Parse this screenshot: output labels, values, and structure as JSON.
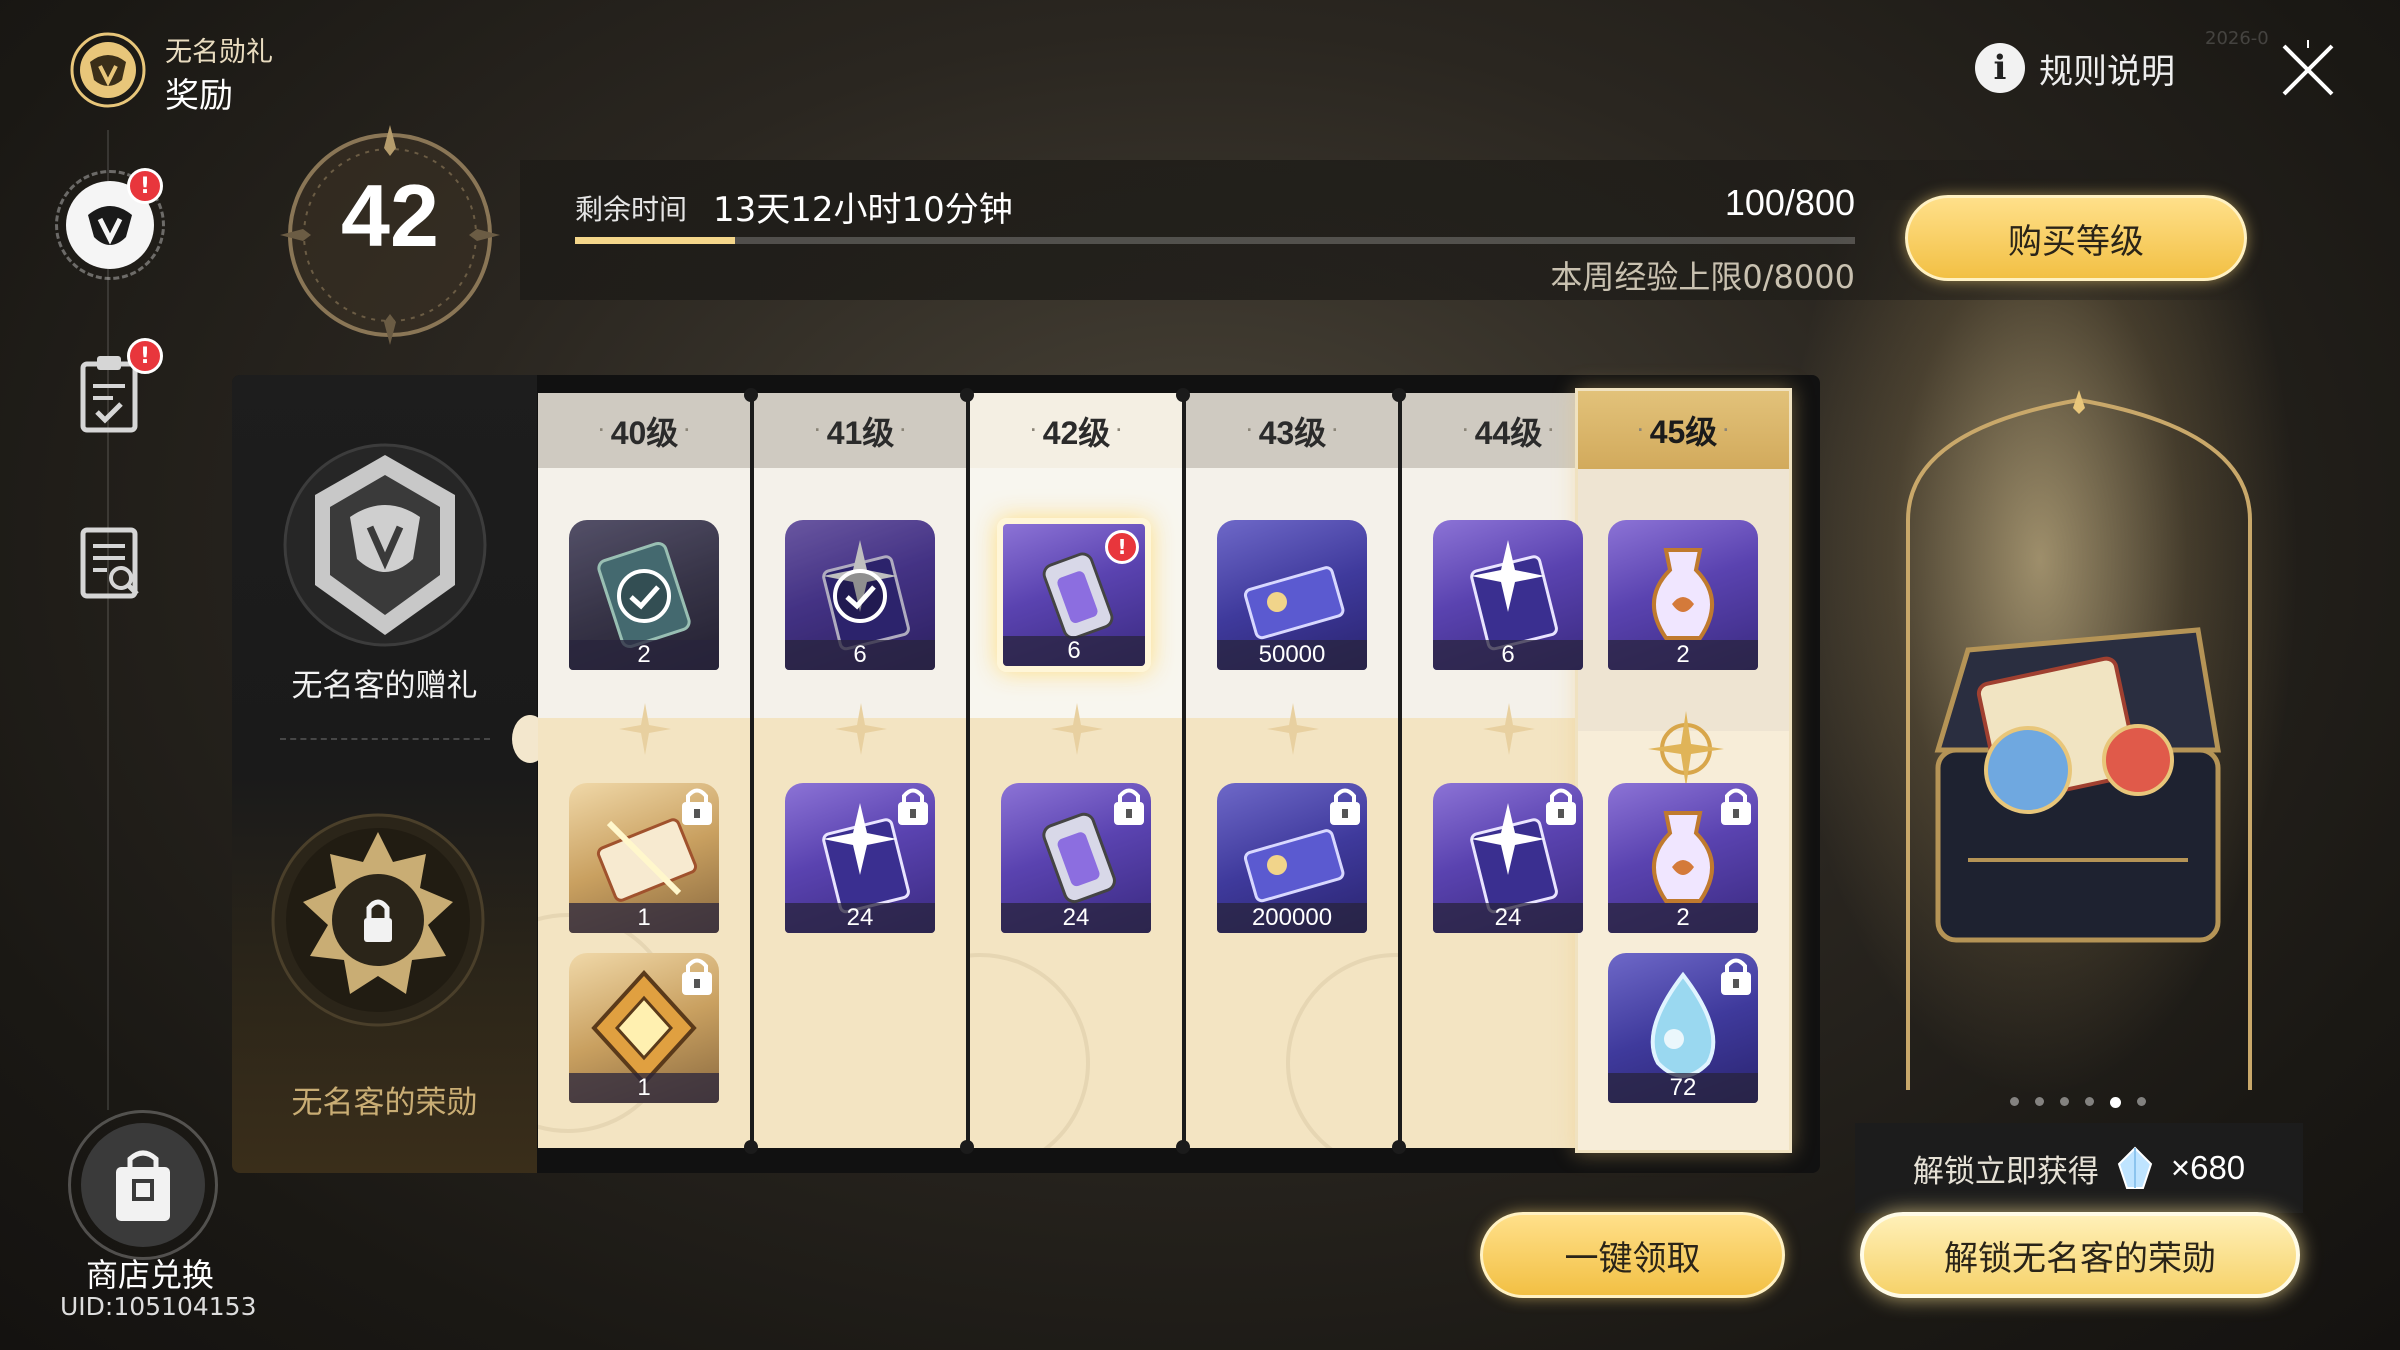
{
  "header": {
    "subtitle": "无名勋礼",
    "title": "奖励",
    "rules_label": "规则说明",
    "timestamp": "2026-0"
  },
  "level": {
    "current": "42",
    "remaining_label": "剩余时间",
    "remaining_value": "13天12小时10分钟",
    "exp": "100/800",
    "exp_progress": 0.125,
    "weekly_cap": "本周经验上限0/8000",
    "buy_label": "购买等级"
  },
  "sidebar": {
    "badge_1": "!",
    "badge_2": "!",
    "shop_label": "商店兑换",
    "uid": "UID:105104153"
  },
  "tracks": {
    "free_label": "无名客的赠礼",
    "paid_label": "无名客的荣勋"
  },
  "columns": [
    {
      "label": "40级",
      "free": [
        {
          "count": "2",
          "icon": "phone-card-icon",
          "claimed": true
        }
      ],
      "paid": [
        {
          "count": "1",
          "icon": "ticket-icon"
        },
        {
          "count": "1",
          "icon": "geometric-crystal-icon"
        }
      ]
    },
    {
      "label": "41级",
      "free": [
        {
          "count": "6",
          "icon": "book-icon",
          "claimed": true
        }
      ],
      "paid": [
        {
          "count": "24",
          "icon": "book-icon"
        }
      ]
    },
    {
      "label": "42级",
      "free": [
        {
          "count": "6",
          "icon": "canister-icon",
          "badge": "!"
        }
      ],
      "paid": [
        {
          "count": "24",
          "icon": "canister-icon"
        }
      ]
    },
    {
      "label": "43级",
      "free": [
        {
          "count": "50000",
          "icon": "credit-icon"
        }
      ],
      "paid": [
        {
          "count": "200000",
          "icon": "credit-icon"
        }
      ]
    },
    {
      "label": "44级",
      "free": [
        {
          "count": "6",
          "icon": "book-icon"
        }
      ],
      "paid": [
        {
          "count": "24",
          "icon": "book-icon"
        }
      ]
    },
    {
      "label": "45级",
      "free": [
        {
          "count": "2",
          "icon": "potion-icon"
        }
      ],
      "paid": [
        {
          "count": "2",
          "icon": "potion-icon"
        },
        {
          "count": "72",
          "icon": "crystal-drop-icon"
        }
      ]
    }
  ],
  "preview": {
    "unlock_tip": "解锁立即获得",
    "unlock_gem_icon": "stellar-jade-icon",
    "unlock_amount": "×680",
    "active_dot": 5,
    "dot_count": 6
  },
  "buttons": {
    "claim_all": "一键领取",
    "unlock": "解锁无名客的荣勋"
  },
  "colors": {
    "accent_gold": "#f2c044",
    "badge_red": "#e8363c"
  }
}
